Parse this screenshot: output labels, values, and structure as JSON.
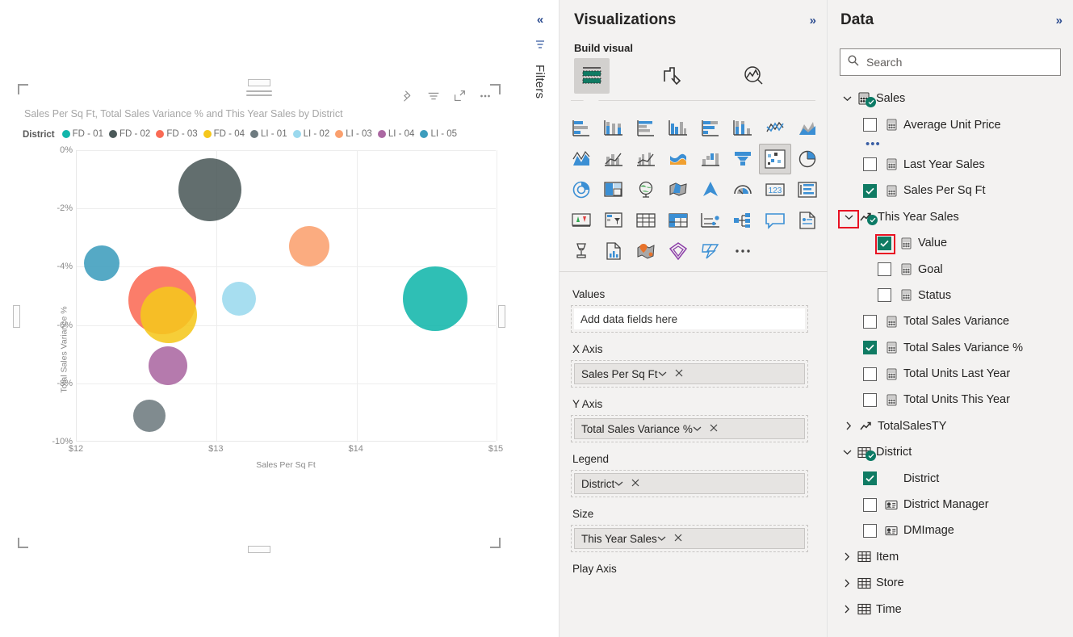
{
  "canvas": {
    "visual": {
      "title": "Sales Per Sq Ft, Total Sales Variance % and This Year Sales by District",
      "header_icons": [
        "pin-icon",
        "filter-icon",
        "focus-mode-icon",
        "more-options-icon"
      ]
    }
  },
  "chart_data": {
    "type": "scatter",
    "title": "Sales Per Sq Ft, Total Sales Variance % and This Year Sales by District",
    "xlabel": "Sales Per Sq Ft",
    "ylabel": "Total Sales Variance %",
    "legend_title": "District",
    "legend_position": "top",
    "grid": true,
    "xlim": [
      12,
      15
    ],
    "ylim": [
      -10,
      0
    ],
    "x_ticks": [
      "$12",
      "$13",
      "$14",
      "$15"
    ],
    "y_ticks": [
      "0%",
      "-2%",
      "-4%",
      "-6%",
      "-8%",
      "-10%"
    ],
    "size_field": "This Year Sales",
    "points": [
      {
        "name": "FD - 01",
        "color": "#12b6ab",
        "x": 14.56,
        "y": -5.1,
        "r": 40
      },
      {
        "name": "FD - 02",
        "color": "#4c5a5a",
        "x": 12.95,
        "y": -1.35,
        "r": 39
      },
      {
        "name": "FD - 03",
        "color": "#fa6b55",
        "x": 12.61,
        "y": -5.15,
        "r": 42
      },
      {
        "name": "FD - 04",
        "color": "#f5c71c",
        "x": 12.66,
        "y": -5.65,
        "r": 35
      },
      {
        "name": "LI - 01",
        "color": "#6e7b80",
        "x": 12.52,
        "y": -9.12,
        "r": 20
      },
      {
        "name": "LI - 02",
        "color": "#9bd9ee",
        "x": 13.16,
        "y": -5.1,
        "r": 21
      },
      {
        "name": "LI - 03",
        "color": "#faa06e",
        "x": 13.66,
        "y": -3.3,
        "r": 25
      },
      {
        "name": "LI - 04",
        "color": "#ab68a2",
        "x": 12.65,
        "y": -7.4,
        "r": 24
      },
      {
        "name": "LI - 05",
        "color": "#3d9dbd",
        "x": 12.18,
        "y": -3.88,
        "r": 22
      }
    ]
  },
  "filters_rail": {
    "expand_label": "«",
    "label": "Filters"
  },
  "visualizations": {
    "title": "Visualizations",
    "collapse_label": "»",
    "build_visual": "Build visual",
    "tabs": [
      {
        "name": "fields-tab",
        "active": true
      },
      {
        "name": "format-tab",
        "active": false
      },
      {
        "name": "analytics-tab",
        "active": false
      }
    ],
    "visual_types": [
      "stacked-bar-chart",
      "stacked-column-chart",
      "clustered-bar-chart",
      "clustered-column-chart",
      "100-stacked-bar-chart",
      "100-stacked-column-chart",
      "line-chart",
      "area-chart",
      "stacked-area-chart",
      "line-and-stacked-column-chart",
      "line-and-clustered-column-chart",
      "ribbon-chart",
      "waterfall-chart",
      "funnel-chart",
      "scatter-chart",
      "pie-chart",
      "donut-chart",
      "treemap",
      "map",
      "filled-map",
      "azure-map",
      "gauge-chart",
      "card",
      "multi-row-card",
      "kpi",
      "slicer",
      "table",
      "matrix",
      "r-script-visual",
      "decomposition-tree",
      "q-and-a",
      "paginated-report",
      "key-influencers",
      "python-visual",
      "arcgis-map",
      "power-apps-visual",
      "power-automate-visual",
      "more-options"
    ],
    "selected_visual_type": "scatter-chart",
    "wells": [
      {
        "label": "Values",
        "value": "Add data fields here",
        "empty": true
      },
      {
        "label": "X Axis",
        "value": "Sales Per Sq Ft",
        "empty": false
      },
      {
        "label": "Y Axis",
        "value": "Total Sales Variance %",
        "empty": false
      },
      {
        "label": "Legend",
        "value": "District",
        "empty": false
      },
      {
        "label": "Size",
        "value": "This Year Sales",
        "empty": false
      },
      {
        "label": "Play Axis",
        "value": "",
        "empty": false
      }
    ],
    "well_chevron": "⌄",
    "well_remove": "✕"
  },
  "data_pane": {
    "title": "Data",
    "collapse_label": "»",
    "search_placeholder": "Search",
    "tree": [
      {
        "kind": "table",
        "label": "Sales",
        "expanded": true,
        "badge": true
      },
      {
        "kind": "field",
        "label": "Average Unit Price",
        "checked": false,
        "indent": 1,
        "icon": "measure-icon"
      },
      {
        "kind": "more",
        "label": "..."
      },
      {
        "kind": "field",
        "label": "Last Year Sales",
        "checked": false,
        "indent": 1,
        "icon": "measure-icon"
      },
      {
        "kind": "field",
        "label": "Sales Per Sq Ft",
        "checked": true,
        "indent": 1,
        "icon": "measure-icon"
      },
      {
        "kind": "group",
        "label": "This Year Sales",
        "expanded": true,
        "badge": true,
        "indent": 1,
        "icon": "kpi-icon",
        "highlight_chevron": true
      },
      {
        "kind": "field",
        "label": "Value",
        "checked": true,
        "indent": 2,
        "icon": "measure-icon",
        "highlight_checkbox": true
      },
      {
        "kind": "field",
        "label": "Goal",
        "checked": false,
        "indent": 2,
        "icon": "measure-icon"
      },
      {
        "kind": "field",
        "label": "Status",
        "checked": false,
        "indent": 2,
        "icon": "measure-icon"
      },
      {
        "kind": "field",
        "label": "Total Sales Variance",
        "checked": false,
        "indent": 1,
        "icon": "measure-icon"
      },
      {
        "kind": "field",
        "label": "Total Sales Variance %",
        "checked": true,
        "indent": 1,
        "icon": "measure-icon"
      },
      {
        "kind": "field",
        "label": "Total Units Last Year",
        "checked": false,
        "indent": 1,
        "icon": "measure-icon"
      },
      {
        "kind": "field",
        "label": "Total Units This Year",
        "checked": false,
        "indent": 1,
        "icon": "measure-icon"
      },
      {
        "kind": "group",
        "label": "TotalSalesTY",
        "expanded": false,
        "indent": 1,
        "icon": "kpi-icon"
      },
      {
        "kind": "table",
        "label": "District",
        "expanded": true,
        "badge": true
      },
      {
        "kind": "field",
        "label": "District",
        "checked": true,
        "indent": 1,
        "icon": "none"
      },
      {
        "kind": "field",
        "label": "District Manager",
        "checked": false,
        "indent": 1,
        "icon": "text-icon"
      },
      {
        "kind": "field",
        "label": "DMImage",
        "checked": false,
        "indent": 1,
        "icon": "text-icon"
      },
      {
        "kind": "table",
        "label": "Item",
        "expanded": false
      },
      {
        "kind": "table",
        "label": "Store",
        "expanded": false
      },
      {
        "kind": "table",
        "label": "Time",
        "expanded": false
      }
    ]
  },
  "colors": {
    "accent": "#0f7b63",
    "highlight": "#e81123",
    "pane_bg": "#f3f2f1",
    "link": "#2b4b8f"
  }
}
